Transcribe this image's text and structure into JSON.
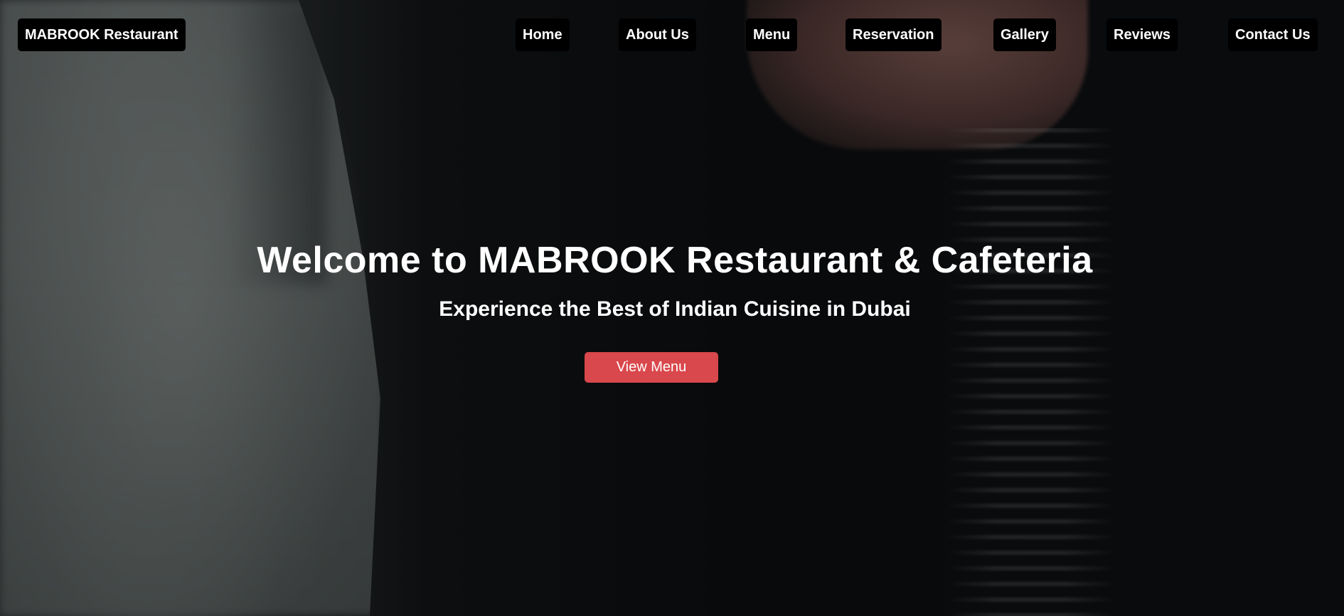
{
  "nav": {
    "brand": "MABROOK Restaurant",
    "items": [
      {
        "label": "Home"
      },
      {
        "label": "About Us"
      },
      {
        "label": "Menu"
      },
      {
        "label": "Reservation"
      },
      {
        "label": "Gallery"
      },
      {
        "label": "Reviews"
      },
      {
        "label": "Contact Us"
      }
    ]
  },
  "hero": {
    "title": "Welcome to MABROOK Restaurant & Cafeteria",
    "subtitle": "Experience the Best of Indian Cuisine in Dubai",
    "cta_label": "View Menu"
  },
  "colors": {
    "nav_background": "#000000",
    "nav_text": "#ffffff",
    "cta_background": "#d9484c",
    "hero_text": "#ffffff"
  }
}
